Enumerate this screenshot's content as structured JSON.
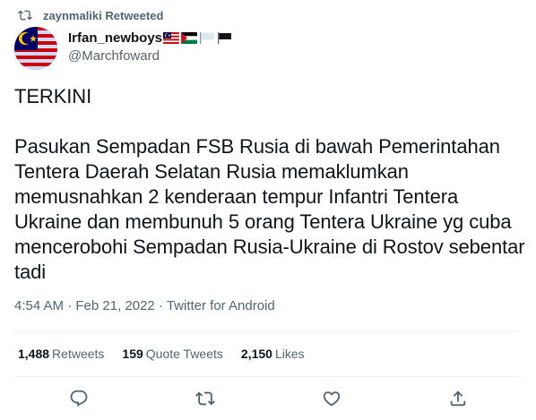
{
  "retweet_banner": {
    "text": "zaynmaliki Retweeted",
    "icon": "retweet-icon"
  },
  "author": {
    "display_name": "Irfan_newboys",
    "handle": "@Marchfoward",
    "flags": [
      "malaysia-flag",
      "palestine-flag",
      "white-flag",
      "black-flag"
    ]
  },
  "tweet": {
    "text": "TERKINI\n\nPasukan Sempadan FSB Rusia di bawah Pemerintahan Tentera Daerah Selatan Rusia memaklumkan memusnahkan 2 kenderaan tempur Infantri Tentera Ukraine dan membunuh 5 orang Tentera Ukraine yg cuba mencerobohi Sempadan Rusia-Ukraine di Rostov sebentar tadi",
    "meta": "4:54 AM · Feb 21, 2022 · Twitter for Android"
  },
  "stats": {
    "retweets_count": "1,488",
    "retweets_label": "Retweets",
    "quotes_count": "159",
    "quotes_label": "Quote Tweets",
    "likes_count": "2,150",
    "likes_label": "Likes"
  },
  "actions": [
    "reply-icon",
    "retweet-icon",
    "like-icon",
    "share-icon"
  ],
  "colors": {
    "text": "#0f1419",
    "secondary": "#536471",
    "divider": "#eff3f4"
  }
}
